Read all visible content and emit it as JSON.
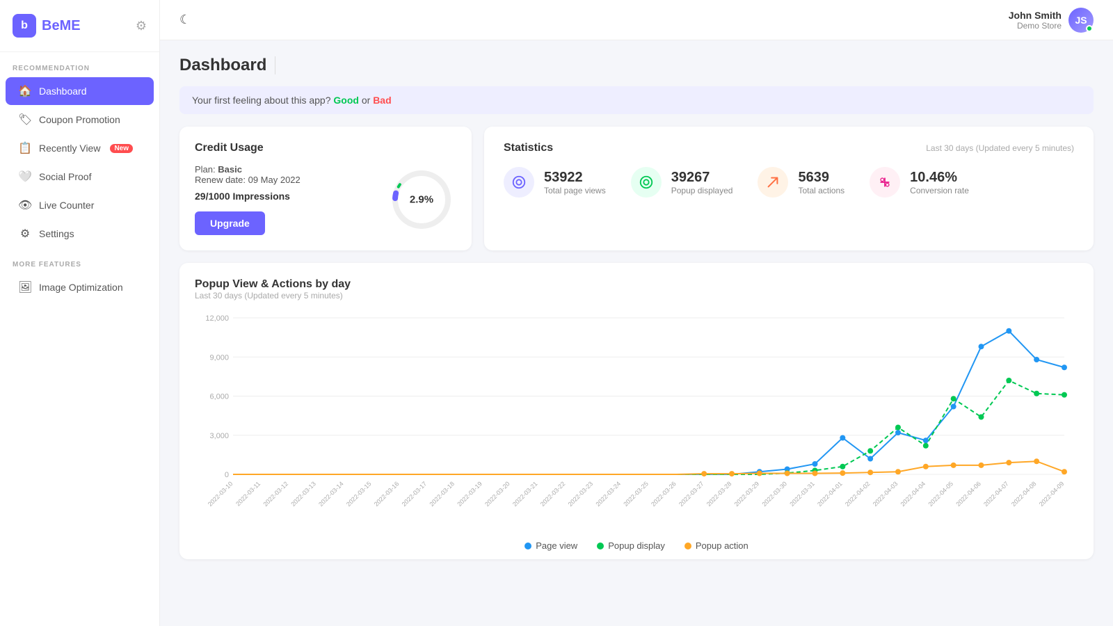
{
  "sidebar": {
    "logo_letter": "b",
    "logo_text": "BeME",
    "sections": [
      {
        "label": "RECOMMENDATION",
        "items": [
          {
            "id": "dashboard",
            "icon": "🏠",
            "label": "Dashboard",
            "active": true
          },
          {
            "id": "coupon",
            "icon": "🏷",
            "label": "Coupon Promotion",
            "active": false
          },
          {
            "id": "recently",
            "icon": "📋",
            "label": "Recently View",
            "badge": "New",
            "active": false
          },
          {
            "id": "social",
            "icon": "🤍",
            "label": "Social Proof",
            "active": false
          },
          {
            "id": "live",
            "icon": "👁",
            "label": "Live Counter",
            "active": false
          },
          {
            "id": "settings",
            "icon": "⚙",
            "label": "Settings",
            "active": false
          }
        ]
      },
      {
        "label": "MORE FEATURES",
        "items": [
          {
            "id": "image-opt",
            "icon": "🖼",
            "label": "Image Optimization",
            "active": false
          }
        ]
      }
    ]
  },
  "topbar": {
    "moon_icon": "☾",
    "user_name": "John Smith",
    "user_store": "Demo Store"
  },
  "page": {
    "title": "Dashboard"
  },
  "feedback": {
    "text": "Your first feeling about this app?",
    "good": "Good",
    "or": " or ",
    "bad": "Bad"
  },
  "credit": {
    "title": "Credit Usage",
    "plan_label": "Plan:",
    "plan_name": "Basic",
    "renew": "Renew date: 09 May 2022",
    "impressions": "29/1000 Impressions",
    "percent": "2.9%",
    "upgrade_label": "Upgrade"
  },
  "stats": {
    "title": "Statistics",
    "updated": "Last 30 days (Updated every 5 minutes)",
    "items": [
      {
        "value": "53922",
        "label": "Total page views",
        "icon_class": "stat-icon-blue",
        "icon": "👁"
      },
      {
        "value": "39267",
        "label": "Popup displayed",
        "icon_class": "stat-icon-green",
        "icon": "🔵"
      },
      {
        "value": "5639",
        "label": "Total actions",
        "icon_class": "stat-icon-orange",
        "icon": "↗"
      },
      {
        "value": "10.46%",
        "label": "Conversion rate",
        "icon_class": "stat-icon-pink",
        "icon": "÷"
      }
    ]
  },
  "chart": {
    "title": "Popup View & Actions by day",
    "subtitle": "Last 30 days (Updated every 5 minutes)",
    "y_labels": [
      "12000",
      "9000",
      "6000",
      "3000",
      "0"
    ],
    "x_labels": [
      "2022-03-10",
      "2022-03-11",
      "2022-03-12",
      "2022-03-13",
      "2022-03-14",
      "2022-03-15",
      "2022-03-16",
      "2022-03-17",
      "2022-03-18",
      "2022-03-19",
      "2022-03-20",
      "2022-03-21",
      "2022-03-22",
      "2022-03-23",
      "2022-03-24",
      "2022-03-25",
      "2022-03-26",
      "2022-03-27",
      "2022-03-28",
      "2022-03-29",
      "2022-03-30",
      "2022-03-31",
      "2022-04-01",
      "2022-04-02",
      "2022-04-03",
      "2022-04-04",
      "2022-04-05",
      "2022-04-06",
      "2022-04-07",
      "2022-04-08",
      "2022-04-09"
    ],
    "legend": [
      {
        "label": "Page view",
        "color": "#2196f3"
      },
      {
        "label": "Popup display",
        "color": "#00c853"
      },
      {
        "label": "Popup action",
        "color": "#ffa726"
      }
    ],
    "page_view": [
      0,
      0,
      0,
      0,
      0,
      0,
      0,
      0,
      0,
      0,
      0,
      0,
      0,
      0,
      0,
      0,
      0,
      0,
      0,
      200,
      400,
      800,
      2800,
      1200,
      3200,
      2600,
      5200,
      9800,
      11000,
      8800,
      8200
    ],
    "popup_display": [
      0,
      0,
      0,
      0,
      0,
      0,
      0,
      0,
      0,
      0,
      0,
      0,
      0,
      0,
      0,
      0,
      0,
      0,
      0,
      0,
      100,
      300,
      600,
      1800,
      3600,
      2200,
      5800,
      4400,
      7200,
      6200,
      6100
    ],
    "popup_action": [
      0,
      0,
      0,
      0,
      0,
      0,
      0,
      0,
      0,
      0,
      0,
      0,
      0,
      0,
      0,
      0,
      0,
      50,
      50,
      80,
      80,
      80,
      100,
      150,
      200,
      600,
      700,
      700,
      900,
      1000,
      200
    ]
  }
}
